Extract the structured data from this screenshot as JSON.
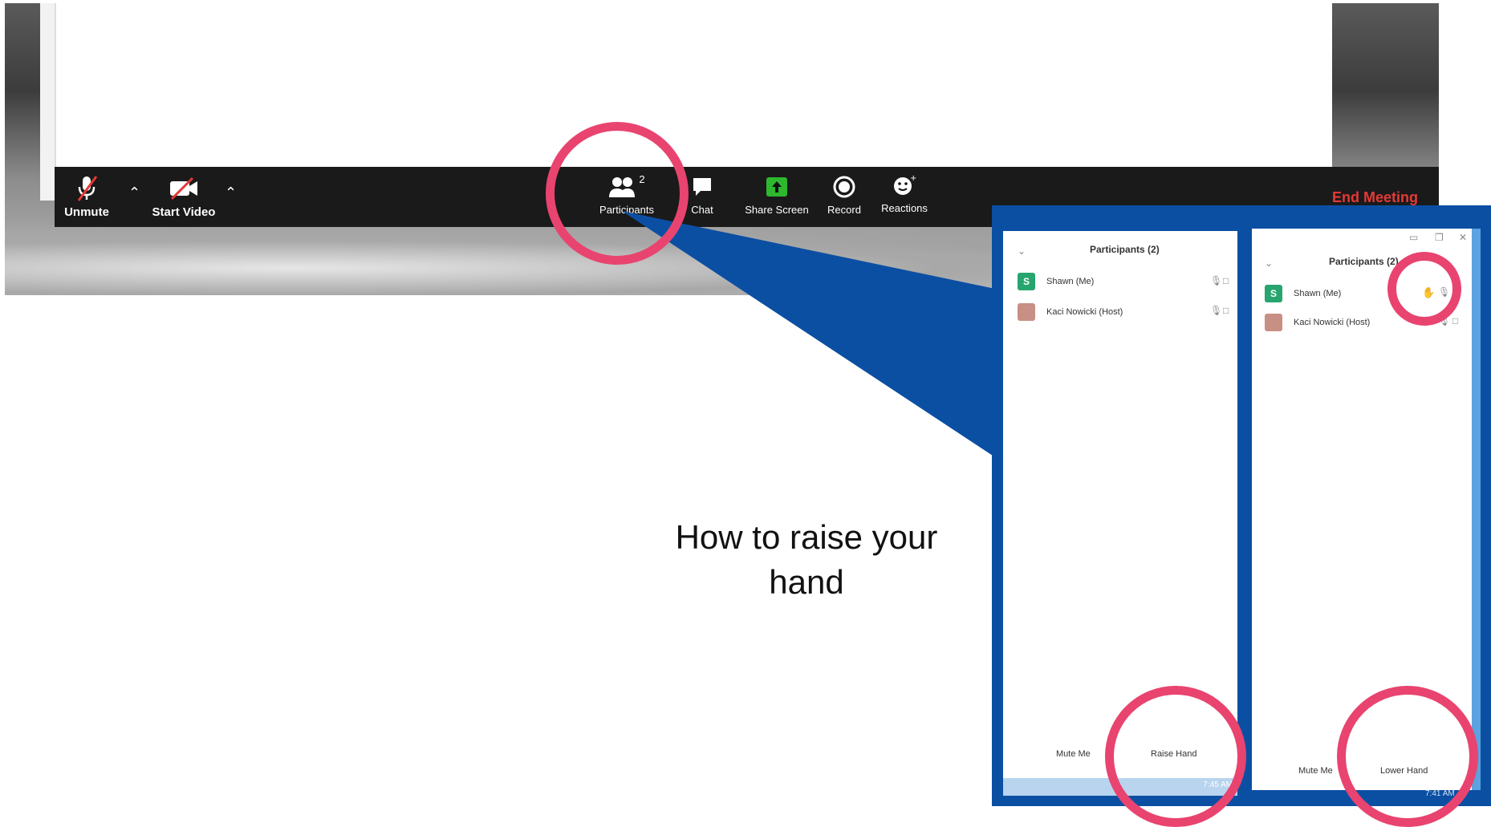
{
  "toolbar": {
    "unmute_label": "Unmute",
    "start_video_label": "Start Video",
    "participants_label": "Participants",
    "participants_count": "2",
    "chat_label": "Chat",
    "share_screen_label": "Share Screen",
    "record_label": "Record",
    "reactions_label": "Reactions",
    "end_meeting_label": "End Meeting"
  },
  "panel_left": {
    "title": "Participants (2)",
    "participants": [
      {
        "initial": "S",
        "name": "Shawn (Me)"
      },
      {
        "name": "Kaci Nowicki (Host)"
      }
    ],
    "mute_me_label": "Mute Me",
    "raise_hand_label": "Raise Hand",
    "clock": "7:45 AM"
  },
  "panel_right": {
    "title": "Participants (2)",
    "participants": [
      {
        "initial": "S",
        "name": "Shawn (Me)"
      },
      {
        "name": "Kaci Nowicki (Host)"
      }
    ],
    "mute_me_label": "Mute Me",
    "lower_hand_label": "Lower Hand",
    "clock": "7:41 AM"
  },
  "caption": {
    "line1": "How to raise your",
    "line2": "hand"
  },
  "colors": {
    "highlight_ring": "#e8446f",
    "callout_blue": "#0b4fa3",
    "end_meeting_red": "#e53935",
    "share_green": "#2eb82e"
  }
}
